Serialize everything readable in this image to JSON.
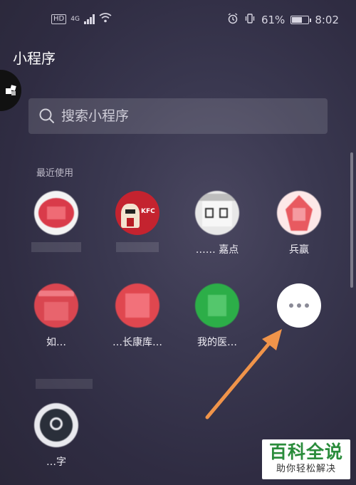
{
  "status_bar": {
    "hd_badge": "HD",
    "network": "4G",
    "battery": "61%",
    "time": "8:02"
  },
  "page": {
    "title": "小程序"
  },
  "search": {
    "placeholder": "搜索小程序"
  },
  "section": {
    "recent_label": "最近使用"
  },
  "apps": [
    {
      "label": "",
      "color": "#d93b4a"
    },
    {
      "label": "",
      "color": "#c4232f",
      "badge": "KFC"
    },
    {
      "label": "…… 嘉点",
      "color": "#e8e8e8"
    },
    {
      "label": "兵赢",
      "color": "#e85a60"
    },
    {
      "label": "如…",
      "color": "#d94650"
    },
    {
      "label": "…长康库…",
      "color": "#e0474f"
    },
    {
      "label": "我的医…",
      "color": "#2cae48"
    },
    {
      "label": "",
      "color": "#2a2f3a"
    }
  ],
  "last_app": {
    "label": "…字"
  },
  "watermark": {
    "main": "百科全说",
    "sub": "助你轻松解决"
  },
  "colors": {
    "arrow": "#f0944a",
    "watermark_green": "#2a8c3b"
  }
}
